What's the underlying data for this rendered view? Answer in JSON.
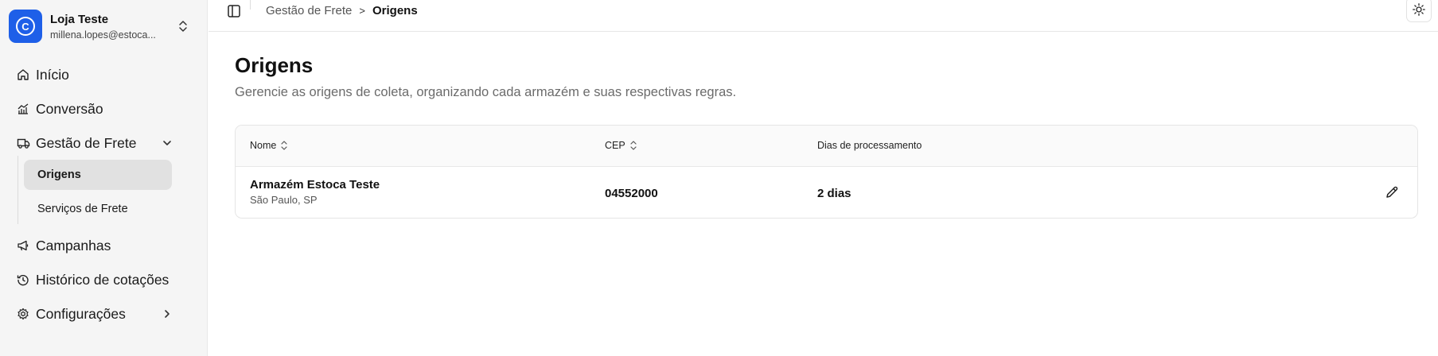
{
  "store": {
    "initial": "C",
    "name": "Loja Teste",
    "email": "millena.lopes@estoca..."
  },
  "nav": {
    "inicio": "Início",
    "conversao": "Conversão",
    "gestao_frete": "Gestão de Frete",
    "origens": "Origens",
    "servicos_frete": "Serviços de Frete",
    "campanhas": "Campanhas",
    "historico": "Histórico de cotações",
    "configuracoes": "Configurações"
  },
  "breadcrumb": {
    "parent": "Gestão de Frete",
    "separator": ">",
    "current": "Origens"
  },
  "page": {
    "title": "Origens",
    "subtitle": "Gerencie as origens de coleta, organizando cada armazém e suas respectivas regras."
  },
  "table": {
    "columns": {
      "nome": "Nome",
      "cep": "CEP",
      "dias": "Dias de processamento"
    },
    "rows": [
      {
        "name": "Armazém Estoca Teste",
        "location": "São Paulo, SP",
        "cep": "04552000",
        "dias": "2 dias"
      }
    ]
  },
  "colors": {
    "brand": "#1e5fe8",
    "sidebar_bg": "#f5f5f5",
    "active_bg": "#e1e1e1"
  },
  "icons": [
    "home-icon",
    "chart-icon",
    "truck-icon",
    "megaphone-icon",
    "history-icon",
    "settings-icon",
    "sidebar-toggle-icon",
    "sun-icon",
    "pencil-icon",
    "sort-icon",
    "chevron-down-icon",
    "chevron-right-icon"
  ]
}
